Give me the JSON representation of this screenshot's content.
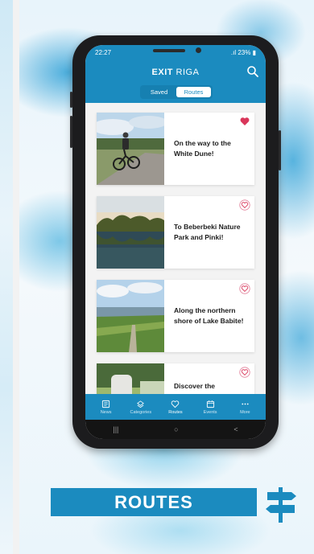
{
  "colors": {
    "brand": "#1b8bbf",
    "heart_filled": "#d9365a",
    "heart_outline": "#e07a95"
  },
  "status_bar": {
    "time": "22:27",
    "battery": "23%"
  },
  "header": {
    "title_bold": "EXIT",
    "title_light": "RIGA",
    "search_icon": "search-icon"
  },
  "segments": [
    {
      "label": "Saved",
      "active": false
    },
    {
      "label": "Routes",
      "active": true
    }
  ],
  "routes": [
    {
      "title": "On the way to the White Dune!",
      "favorited": true
    },
    {
      "title": "To Beberbeki Nature Park and Pinki!",
      "favorited": false
    },
    {
      "title": "Along the northern shore of Lake Babite!",
      "favorited": false
    },
    {
      "title": "Discover the",
      "favorited": false
    }
  ],
  "tabs": [
    {
      "label": "News",
      "icon": "news-icon"
    },
    {
      "label": "Categories",
      "icon": "categories-icon"
    },
    {
      "label": "Routes",
      "icon": "heart-icon",
      "active": true
    },
    {
      "label": "Events",
      "icon": "calendar-icon"
    },
    {
      "label": "More",
      "icon": "more-icon"
    }
  ],
  "nav": {
    "recent": "|||",
    "home": "○",
    "back": "<"
  },
  "banner": {
    "label": "ROUTES"
  }
}
